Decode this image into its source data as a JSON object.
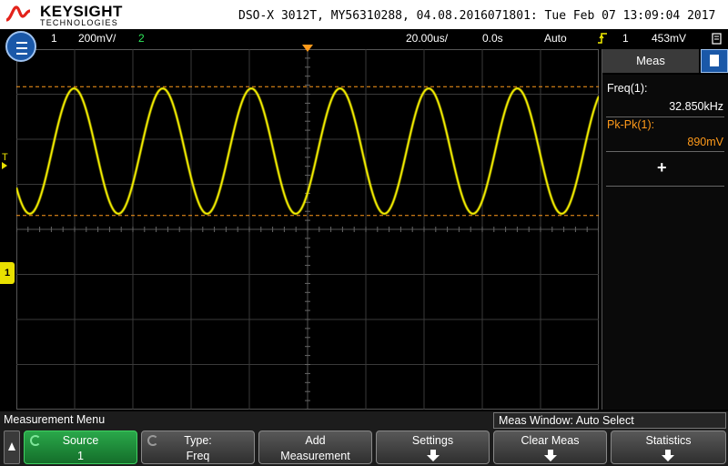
{
  "header": {
    "brand": "KEYSIGHT",
    "brand_sub": "TECHNOLOGIES",
    "device_info": "DSO-X 3012T, MY56310288, 04.08.2016071801: Tue Feb 07 13:09:04 2017"
  },
  "status": {
    "ch1_num": "1",
    "ch1_scale": "200mV/",
    "ch2_num": "2",
    "timebase": "20.00us/",
    "delay": "0.0s",
    "trigger_mode": "Auto",
    "trigger_source": "1",
    "trigger_level": "453mV"
  },
  "trace": {
    "color": "#f5ef00",
    "cycles_on_screen": 6.57,
    "amplitude_divs": 2.78,
    "offset_divs": 0
  },
  "meas": {
    "tab_label": "Meas",
    "rows": [
      {
        "label": "Freq(1):",
        "value": "32.850kHz",
        "color": "#ffffff"
      },
      {
        "label": "Pk-Pk(1):",
        "value": "890mV",
        "color": "#ff9a1a"
      }
    ],
    "add_symbol": "+"
  },
  "bottom": {
    "menu_title": "Measurement Menu",
    "window_status": "Meas Window: Auto Select",
    "softkeys": [
      {
        "line1": "Source",
        "line2": "1"
      },
      {
        "line1": "Type:",
        "line2": "Freq"
      },
      {
        "line1": "Add",
        "line2": "Measurement"
      },
      {
        "line1": "Settings",
        "line2": ""
      },
      {
        "line1": "Clear Meas",
        "line2": ""
      },
      {
        "line1": "Statistics",
        "line2": ""
      }
    ]
  },
  "markers": {
    "channel": "1",
    "trigger_label": "T"
  }
}
